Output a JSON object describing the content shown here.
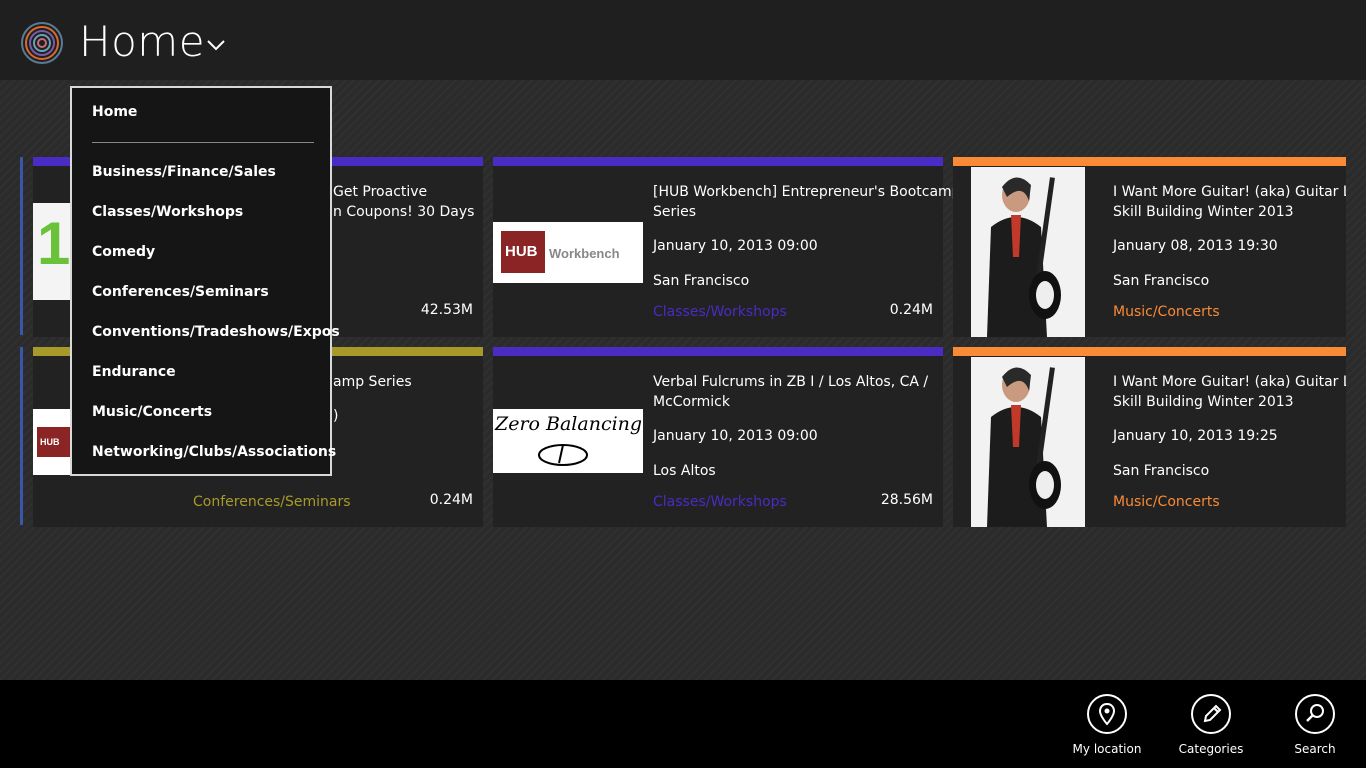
{
  "header": {
    "title": "Home"
  },
  "menu": {
    "items": [
      "Home",
      "Business/Finance/Sales",
      "Classes/Workshops",
      "Comedy",
      "Conferences/Seminars",
      "Conventions/Tradeshows/Expos",
      "Endurance",
      "Music/Concerts",
      "Networking/Clubs/Associations"
    ]
  },
  "cards": [
    {
      "title": "Get Proactive / Coupons! 30 Days",
      "title_line1": "Get Proactive",
      "title_line2": "n Coupons! 30 Days",
      "date": "",
      "city": "",
      "category": "",
      "size": "42.53M",
      "accent": "#4a2bc4"
    },
    {
      "title_line1": "[HUB Workbench] Entrepreneur's Bootcamp",
      "title_line2": "Series",
      "date": "January 10, 2013 09:00",
      "city": "San Francisco",
      "category": "Classes/Workshops",
      "size": "0.24M",
      "accent": "#4a2bc4",
      "thumb_text_a": "HUB",
      "thumb_text_b": "Workbench"
    },
    {
      "title_line1": "I Want More Guitar! (aka) Guitar Lev",
      "title_line2": "Skill Building Winter 2013",
      "date": "January 08, 2013 19:30",
      "city": "San Francisco",
      "category": "Music/Concerts",
      "size": "",
      "accent": "#f98a36"
    },
    {
      "title_line1": "amp Series",
      "title_line2": ")",
      "date": "",
      "city": "",
      "category": "Conferences/Seminars",
      "size": "0.24M",
      "accent": "#a89a2a",
      "thumb_text_a": "HUB",
      "thumb_text_b": "W"
    },
    {
      "title_line1": "Verbal Fulcrums in ZB I / Los Altos, CA /",
      "title_line2": "McCormick",
      "date": "January 10, 2013 09:00",
      "city": "Los Altos",
      "category": "Classes/Workshops",
      "size": "28.56M",
      "accent": "#4a2bc4",
      "thumb_text_a": "Zero Balancing"
    },
    {
      "title_line1": "I Want More Guitar! (aka) Guitar Lev",
      "title_line2": "Skill Building Winter 2013",
      "date": "January 10, 2013 19:25",
      "city": "San Francisco",
      "category": "Music/Concerts",
      "size": "",
      "accent": "#f98a36"
    }
  ],
  "appbar": {
    "my_location": "My location",
    "categories": "Categories",
    "search": "Search"
  },
  "colors": {
    "purple": "#4a2bc4",
    "orange": "#f98a36",
    "olive": "#a89a2a"
  }
}
